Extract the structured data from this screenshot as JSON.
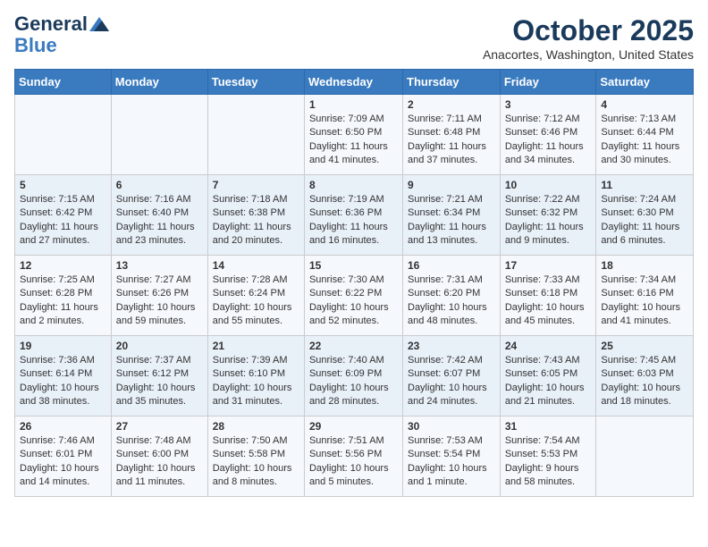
{
  "header": {
    "logo_general": "General",
    "logo_blue": "Blue",
    "month_title": "October 2025",
    "location": "Anacortes, Washington, United States"
  },
  "days_of_week": [
    "Sunday",
    "Monday",
    "Tuesday",
    "Wednesday",
    "Thursday",
    "Friday",
    "Saturday"
  ],
  "weeks": [
    [
      {
        "day": "",
        "text": ""
      },
      {
        "day": "",
        "text": ""
      },
      {
        "day": "",
        "text": ""
      },
      {
        "day": "1",
        "text": "Sunrise: 7:09 AM\nSunset: 6:50 PM\nDaylight: 11 hours and 41 minutes."
      },
      {
        "day": "2",
        "text": "Sunrise: 7:11 AM\nSunset: 6:48 PM\nDaylight: 11 hours and 37 minutes."
      },
      {
        "day": "3",
        "text": "Sunrise: 7:12 AM\nSunset: 6:46 PM\nDaylight: 11 hours and 34 minutes."
      },
      {
        "day": "4",
        "text": "Sunrise: 7:13 AM\nSunset: 6:44 PM\nDaylight: 11 hours and 30 minutes."
      }
    ],
    [
      {
        "day": "5",
        "text": "Sunrise: 7:15 AM\nSunset: 6:42 PM\nDaylight: 11 hours and 27 minutes."
      },
      {
        "day": "6",
        "text": "Sunrise: 7:16 AM\nSunset: 6:40 PM\nDaylight: 11 hours and 23 minutes."
      },
      {
        "day": "7",
        "text": "Sunrise: 7:18 AM\nSunset: 6:38 PM\nDaylight: 11 hours and 20 minutes."
      },
      {
        "day": "8",
        "text": "Sunrise: 7:19 AM\nSunset: 6:36 PM\nDaylight: 11 hours and 16 minutes."
      },
      {
        "day": "9",
        "text": "Sunrise: 7:21 AM\nSunset: 6:34 PM\nDaylight: 11 hours and 13 minutes."
      },
      {
        "day": "10",
        "text": "Sunrise: 7:22 AM\nSunset: 6:32 PM\nDaylight: 11 hours and 9 minutes."
      },
      {
        "day": "11",
        "text": "Sunrise: 7:24 AM\nSunset: 6:30 PM\nDaylight: 11 hours and 6 minutes."
      }
    ],
    [
      {
        "day": "12",
        "text": "Sunrise: 7:25 AM\nSunset: 6:28 PM\nDaylight: 11 hours and 2 minutes."
      },
      {
        "day": "13",
        "text": "Sunrise: 7:27 AM\nSunset: 6:26 PM\nDaylight: 10 hours and 59 minutes."
      },
      {
        "day": "14",
        "text": "Sunrise: 7:28 AM\nSunset: 6:24 PM\nDaylight: 10 hours and 55 minutes."
      },
      {
        "day": "15",
        "text": "Sunrise: 7:30 AM\nSunset: 6:22 PM\nDaylight: 10 hours and 52 minutes."
      },
      {
        "day": "16",
        "text": "Sunrise: 7:31 AM\nSunset: 6:20 PM\nDaylight: 10 hours and 48 minutes."
      },
      {
        "day": "17",
        "text": "Sunrise: 7:33 AM\nSunset: 6:18 PM\nDaylight: 10 hours and 45 minutes."
      },
      {
        "day": "18",
        "text": "Sunrise: 7:34 AM\nSunset: 6:16 PM\nDaylight: 10 hours and 41 minutes."
      }
    ],
    [
      {
        "day": "19",
        "text": "Sunrise: 7:36 AM\nSunset: 6:14 PM\nDaylight: 10 hours and 38 minutes."
      },
      {
        "day": "20",
        "text": "Sunrise: 7:37 AM\nSunset: 6:12 PM\nDaylight: 10 hours and 35 minutes."
      },
      {
        "day": "21",
        "text": "Sunrise: 7:39 AM\nSunset: 6:10 PM\nDaylight: 10 hours and 31 minutes."
      },
      {
        "day": "22",
        "text": "Sunrise: 7:40 AM\nSunset: 6:09 PM\nDaylight: 10 hours and 28 minutes."
      },
      {
        "day": "23",
        "text": "Sunrise: 7:42 AM\nSunset: 6:07 PM\nDaylight: 10 hours and 24 minutes."
      },
      {
        "day": "24",
        "text": "Sunrise: 7:43 AM\nSunset: 6:05 PM\nDaylight: 10 hours and 21 minutes."
      },
      {
        "day": "25",
        "text": "Sunrise: 7:45 AM\nSunset: 6:03 PM\nDaylight: 10 hours and 18 minutes."
      }
    ],
    [
      {
        "day": "26",
        "text": "Sunrise: 7:46 AM\nSunset: 6:01 PM\nDaylight: 10 hours and 14 minutes."
      },
      {
        "day": "27",
        "text": "Sunrise: 7:48 AM\nSunset: 6:00 PM\nDaylight: 10 hours and 11 minutes."
      },
      {
        "day": "28",
        "text": "Sunrise: 7:50 AM\nSunset: 5:58 PM\nDaylight: 10 hours and 8 minutes."
      },
      {
        "day": "29",
        "text": "Sunrise: 7:51 AM\nSunset: 5:56 PM\nDaylight: 10 hours and 5 minutes."
      },
      {
        "day": "30",
        "text": "Sunrise: 7:53 AM\nSunset: 5:54 PM\nDaylight: 10 hours and 1 minute."
      },
      {
        "day": "31",
        "text": "Sunrise: 7:54 AM\nSunset: 5:53 PM\nDaylight: 9 hours and 58 minutes."
      },
      {
        "day": "",
        "text": ""
      }
    ]
  ]
}
